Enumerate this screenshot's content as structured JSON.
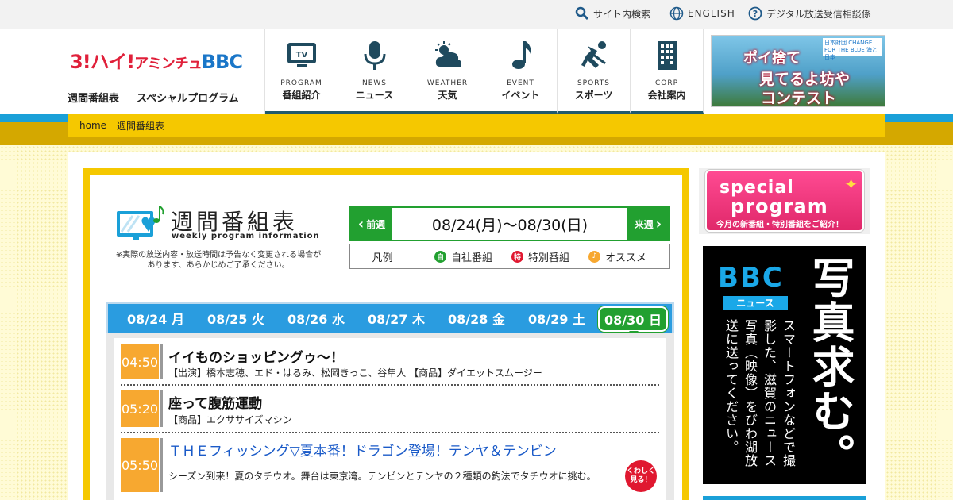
{
  "utility": {
    "search": "サイト内検索",
    "english": "ENGLISH",
    "help": "デジタル放送受信相談係"
  },
  "logo": {
    "part1": "3!",
    "part2": "ハイ!",
    "part3": "アミンチュ",
    "part4": "BBC"
  },
  "sublinks": [
    "週間番組表",
    "スペシャルプログラム"
  ],
  "nav": [
    {
      "en": "PROGRAM",
      "jp": "番組紹介",
      "icon": "tv-icon"
    },
    {
      "en": "NEWS",
      "jp": "ニュース",
      "icon": "microphone-icon"
    },
    {
      "en": "WEATHER",
      "jp": "天気",
      "icon": "weather-icon"
    },
    {
      "en": "EVENT",
      "jp": "イベント",
      "icon": "music-note-icon"
    },
    {
      "en": "SPORTS",
      "jp": "スポーツ",
      "icon": "sports-icon"
    },
    {
      "en": "CORP",
      "jp": "会社案内",
      "icon": "building-icon"
    }
  ],
  "banner_top": {
    "line1": "ポイ捨て",
    "line2": "見てるよ坊や",
    "line3": "コンテスト",
    "badge": "日本財団 CHANGE FOR THE BLUE 海と日本"
  },
  "breadcrumb": [
    "home",
    "週間番組表"
  ],
  "page": {
    "title_jp": "週間番組表",
    "title_en": "weekly program information",
    "note": "※実際の放送内容・放送時間は予告なく変更される場合があります、あらかじめご了承ください。"
  },
  "week": {
    "prev": "前週",
    "range": "08/24(月)～08/30(日)",
    "next": "来週"
  },
  "legend": {
    "label": "凡例",
    "items": [
      {
        "mark": "自",
        "text": "自社番組",
        "color": "#22a030"
      },
      {
        "mark": "特",
        "text": "特別番組",
        "color": "#e01830"
      },
      {
        "mark": "♪",
        "text": "オススメ",
        "color": "#f7a830"
      }
    ]
  },
  "days": [
    "08/24 月",
    "08/25 火",
    "08/26 水",
    "08/27 木",
    "08/28 金",
    "08/29 土",
    "08/30 日"
  ],
  "programs": [
    {
      "time": "04:50",
      "title": "イイものショッピングゥ～！",
      "desc": "【出演】橋本志穂、エド・はるみ、松岡きっこ、谷隼人 【商品】ダイエットスムージー"
    },
    {
      "time": "05:20",
      "title": "座って腹筋運動",
      "desc": "【商品】エクササイズマシン"
    },
    {
      "time": "05:50",
      "title": "ＴＨＥフィッシング▽夏本番！ドラゴン登場！テンヤ＆テンビン",
      "desc": "シーズン到来！夏のタチウオ。舞台は東京湾。テンビンとテンヤの２種類の釣法でタチウオに挑む。",
      "link_color": "#1a5ac8"
    }
  ],
  "detail_button": "くわしく見る！",
  "special": {
    "line1": "special",
    "line2": "program",
    "line3": "今月の新番組・特別番組をご紹介！"
  },
  "bbc_ad": {
    "logo": "BBC",
    "label": "ニュース",
    "big": "写真求む。",
    "small": "スマートフォンなどで撮影した、滋賀のニュース写真（映像）をびわ湖放送に送ってください。"
  }
}
